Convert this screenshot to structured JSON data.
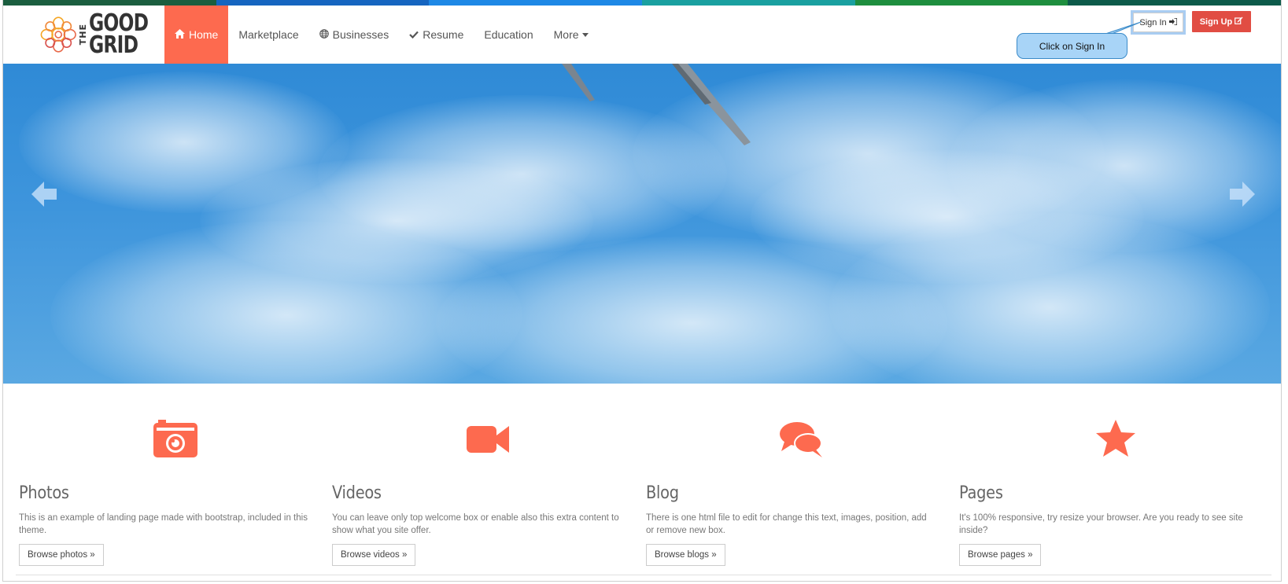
{
  "colors": {
    "accent": "#fd6a4f",
    "signup": "#e14d43",
    "callout_bg": "#a8d4f7",
    "strip": [
      "#1b5e3f",
      "#1565c0",
      "#1e88e5",
      "#1aa0a0",
      "#1e8e3e",
      "#0d5a4a"
    ]
  },
  "logo": {
    "the": "THE",
    "line1": "GOOD",
    "line2": "GRID"
  },
  "nav": {
    "items": [
      {
        "label": "Home",
        "icon": "home-icon",
        "active": true
      },
      {
        "label": "Marketplace",
        "icon": "",
        "active": false
      },
      {
        "label": "Businesses",
        "icon": "globe-icon",
        "active": false
      },
      {
        "label": "Resume",
        "icon": "check-icon",
        "active": false
      },
      {
        "label": "Education",
        "icon": "",
        "active": false
      },
      {
        "label": "More",
        "icon": "caret-down-icon",
        "active": false
      }
    ]
  },
  "auth": {
    "signin_label": "Sign In",
    "signup_label": "Sign Up"
  },
  "callout": {
    "text": "Click on Sign In"
  },
  "carousel": {
    "prev_icon": "arrow-left-icon",
    "next_icon": "arrow-right-icon"
  },
  "features": [
    {
      "title": "Photos",
      "icon": "camera-icon",
      "text": "This is an example of landing page made with bootstrap, included in this theme.",
      "button": "Browse photos »"
    },
    {
      "title": "Videos",
      "icon": "video-camera-icon",
      "text": "You can leave only top welcome box or enable also this extra content to show what you site offer.",
      "button": "Browse videos »"
    },
    {
      "title": "Blog",
      "icon": "comments-icon",
      "text": "There is one html file to edit for change this text, images, position, add or remove new box.",
      "button": "Browse blogs »"
    },
    {
      "title": "Pages",
      "icon": "star-icon",
      "text": "It's 100% responsive, try resize your browser. Are you ready to see site inside?",
      "button": "Browse pages »"
    }
  ]
}
